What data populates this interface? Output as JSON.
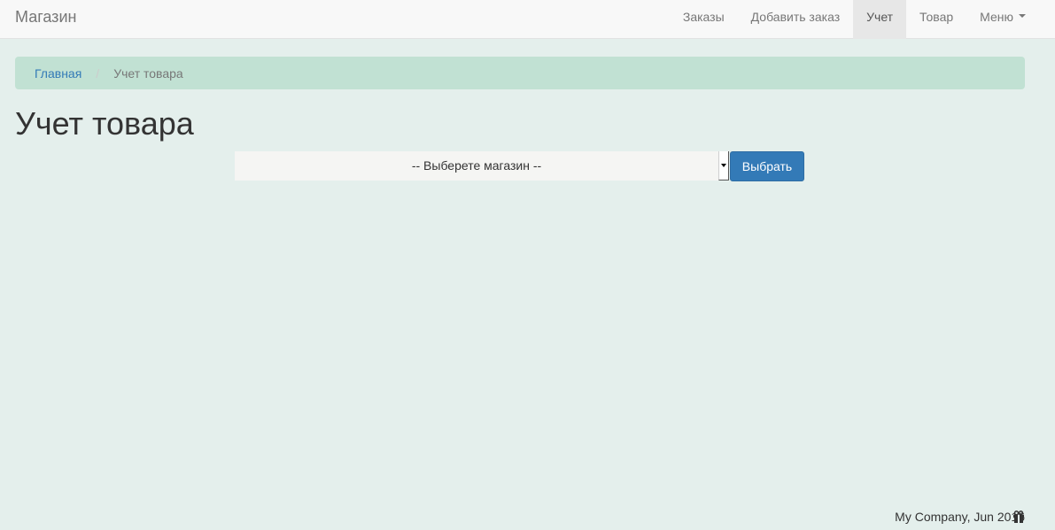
{
  "navbar": {
    "brand": "Магазин",
    "items": [
      {
        "label": "Заказы",
        "active": false
      },
      {
        "label": "Добавить заказ",
        "active": false
      },
      {
        "label": "Учет",
        "active": true
      },
      {
        "label": "Товар",
        "active": false
      },
      {
        "label": "Меню",
        "active": false,
        "dropdown": true
      }
    ]
  },
  "breadcrumb": {
    "home": "Главная",
    "separator": "/",
    "current": "Учет товара"
  },
  "page": {
    "title": "Учет товара"
  },
  "form": {
    "select_value": "-- Выберете магазин --",
    "submit_label": "Выбрать"
  },
  "footer": {
    "text": "My Company, Jun 2016",
    "icon": "gift-icon"
  },
  "colors": {
    "background": "#e4efec",
    "breadcrumb_bg": "#c1e1d3",
    "primary": "#337ab7",
    "link": "#337ab7"
  }
}
